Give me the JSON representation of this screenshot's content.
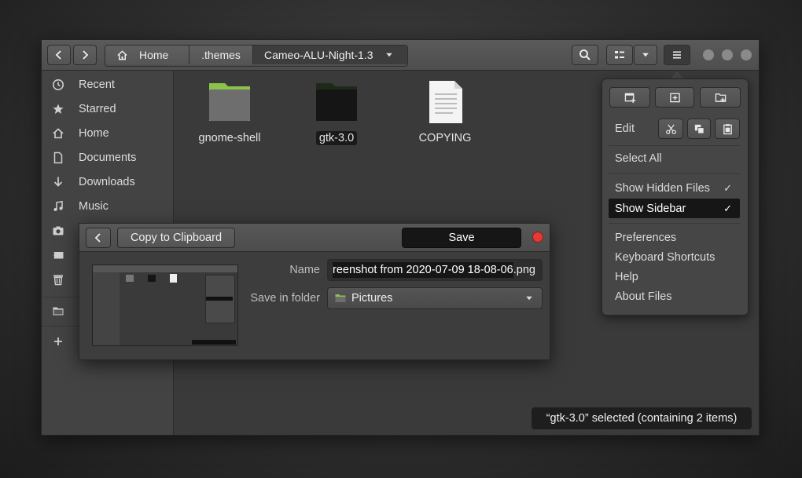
{
  "header": {
    "breadcrumbs": [
      {
        "label": "Home",
        "icon": "home-icon"
      },
      {
        "label": ".themes"
      },
      {
        "label": "Cameo-ALU-Night-1.3"
      }
    ]
  },
  "sidebar": {
    "items": [
      {
        "label": "Recent",
        "icon": "clock-icon"
      },
      {
        "label": "Starred",
        "icon": "star-icon"
      },
      {
        "label": "Home",
        "icon": "home-icon"
      },
      {
        "label": "Documents",
        "icon": "document-icon"
      },
      {
        "label": "Downloads",
        "icon": "download-icon"
      },
      {
        "label": "Music",
        "icon": "music-icon"
      },
      {
        "label": "",
        "icon": "camera-icon"
      },
      {
        "label": "",
        "icon": "video-icon"
      },
      {
        "label": "",
        "icon": "trash-icon"
      },
      {
        "label": "",
        "icon": "folder-icon"
      },
      {
        "label": "",
        "icon": "plus-icon"
      }
    ]
  },
  "files": [
    {
      "name": "gnome-shell",
      "icon": "folder-green-icon"
    },
    {
      "name": "gtk-3.0",
      "icon": "folder-dark-icon",
      "selected": true
    },
    {
      "name": "COPYING",
      "icon": "text-file-icon"
    }
  ],
  "menu": {
    "edit_label": "Edit",
    "select_all": "Select All",
    "show_hidden_files": "Show Hidden Files",
    "show_sidebar": "Show Sidebar",
    "check": "✓",
    "preferences": "Preferences",
    "keyboard_shortcuts": "Keyboard Shortcuts",
    "help": "Help",
    "about": "About Files"
  },
  "dialog": {
    "copy_label": "Copy to Clipboard",
    "save_label": "Save",
    "name_label": "Name",
    "name_value": "reenshot from 2020-07-09 18-08-06",
    "name_ext": ".png",
    "folder_label": "Save in folder",
    "folder_value": "Pictures"
  },
  "status": {
    "text": "“gtk-3.0” selected  (containing 2 items)"
  },
  "colors": {
    "accent_folder": "#8bc34a",
    "selection": "#161616",
    "close_dot": "#e53935"
  }
}
